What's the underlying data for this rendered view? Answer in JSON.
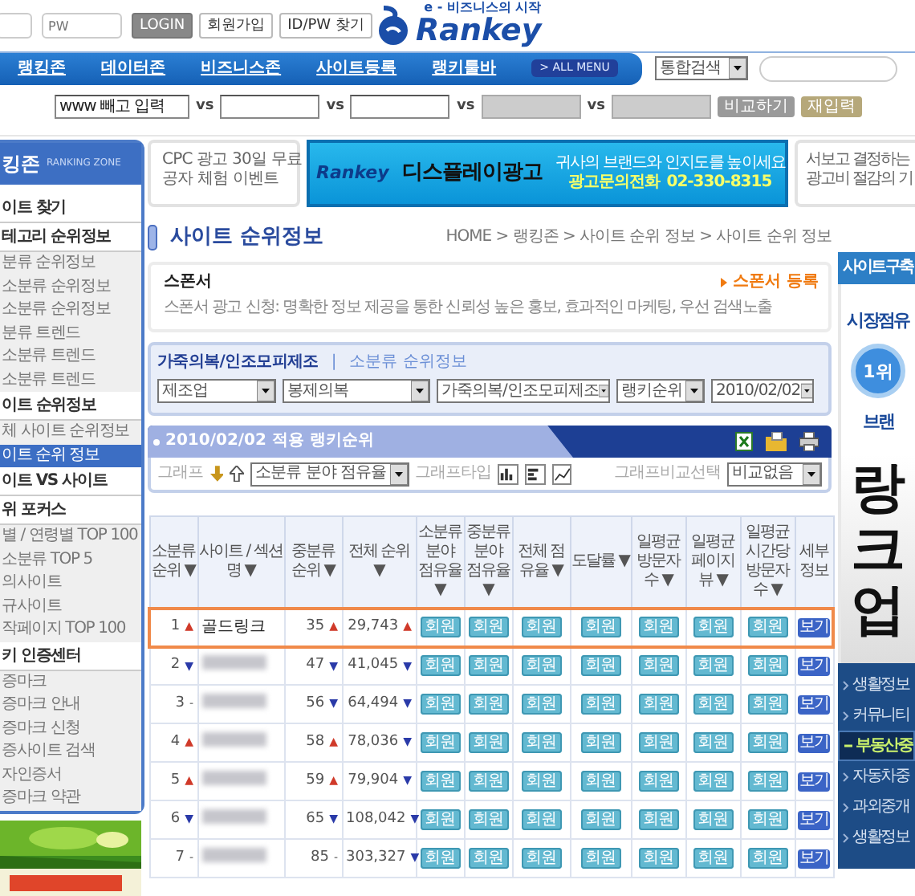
{
  "login": {
    "pw_placeholder": "PW",
    "buttons": [
      "LOGIN",
      "회원가입",
      "ID/PW 찾기"
    ]
  },
  "logo": {
    "tagline": "e - 비즈니스의 시작",
    "name": "Rankey"
  },
  "nav": {
    "items": [
      "랭킹존",
      "데이터존",
      "비즈니스존",
      "사이트등록",
      "랭키툴바"
    ],
    "all_menu": "> ALL MENU",
    "search_scope": "통합검색"
  },
  "compare": {
    "fields": [
      {
        "placeholder": "www 빼고 입력",
        "disabled": false
      },
      {
        "disabled": false
      },
      {
        "disabled": false
      },
      {
        "disabled": true
      },
      {
        "disabled": true
      }
    ],
    "separators": [
      "vs",
      "vs",
      "vs",
      "vs"
    ],
    "buttons": [
      {
        "label": "비교하기",
        "kind": "compare"
      },
      {
        "label": "재입력",
        "kind": "reset"
      }
    ]
  },
  "sidebar": {
    "title": "킹존",
    "subtitle": "RANKING ZONE",
    "items": [
      {
        "label": "이트 찾기",
        "kind": "heading",
        "selected": false
      },
      {
        "label": "테고리 순위정보",
        "kind": "heading",
        "selected": false
      },
      {
        "label": "분류 순위정보",
        "kind": "item",
        "selected": false
      },
      {
        "label": "소분류 순위정보",
        "kind": "item",
        "selected": false
      },
      {
        "label": "소분류 순위정보",
        "kind": "item",
        "selected": false
      },
      {
        "label": "분류 트렌드",
        "kind": "item",
        "selected": false
      },
      {
        "label": "소분류 트렌드",
        "kind": "item",
        "selected": false
      },
      {
        "label": "소분류 트렌드",
        "kind": "item",
        "selected": false
      },
      {
        "label": "이트 순위정보",
        "kind": "heading",
        "selected": false
      },
      {
        "label": "체 사이트 순위정보",
        "kind": "item",
        "selected": false
      },
      {
        "label": "이트 순위 정보",
        "kind": "item",
        "selected": true
      },
      {
        "label": "이트 VS 사이트",
        "kind": "heading",
        "selected": false
      },
      {
        "label": "위 포커스",
        "kind": "heading",
        "selected": false
      },
      {
        "label": "별 / 연령별 TOP 100",
        "kind": "item",
        "selected": false
      },
      {
        "label": "소분류 TOP 5",
        "kind": "item",
        "selected": false
      },
      {
        "label": "의사이트",
        "kind": "item",
        "selected": false
      },
      {
        "label": "규사이트",
        "kind": "item",
        "selected": false
      },
      {
        "label": "작페이지 TOP 100",
        "kind": "item",
        "selected": false
      },
      {
        "label": "키 인증센터",
        "kind": "heading",
        "selected": false
      },
      {
        "label": "증마크",
        "kind": "item",
        "selected": false
      },
      {
        "label": "증마크 안내",
        "kind": "item",
        "selected": false
      },
      {
        "label": "증마크 신청",
        "kind": "item",
        "selected": false
      },
      {
        "label": "증사이트 검색",
        "kind": "item",
        "selected": false
      },
      {
        "label": "자인증서",
        "kind": "item",
        "selected": false
      },
      {
        "label": "증마크 약관",
        "kind": "item",
        "selected": false
      }
    ]
  },
  "ads": {
    "promo": [
      "CPC 광고 30일 무료",
      "공자 체험 이벤트"
    ],
    "display": {
      "brand": "Rankey",
      "title": "디스플레이광고",
      "slogan": "귀사의 브랜드와 인지도를 높이세요",
      "contact_label": "광고문의전화",
      "phone": "02-330-8315"
    },
    "side_promo": [
      "서보고 결정하는",
      "광고비 절감의 기"
    ]
  },
  "page_title": "사이트 순위정보",
  "breadcrumb": "HOME > 랭킹존 > 사이트 순위 정보 > 사이트 순위 정보",
  "sponsor": {
    "title": "스폰서",
    "text": "스폰서 광고 신청: 명확한 정보 제공을 통한 신뢰성 높은 홍보, 효과적인 마케팅, 우선 검색노출",
    "link": "스폰서 등록"
  },
  "filter": {
    "category": "가죽의복/인조모피제조",
    "separator": "|",
    "link": "소분류 순위정보",
    "selects": [
      "제조업",
      "봉제의복",
      "가죽의복/인조모피제조",
      "랭키순위",
      "2010/02/02"
    ]
  },
  "results": {
    "title": "2010/02/02 적용 랭키순위",
    "graph_label": "그래프",
    "graph_metric": "소분류 분야 점유율",
    "type_label": "그래프타입",
    "graph_types": [
      {
        "kind": "bar"
      },
      {
        "kind": "hbar"
      },
      {
        "kind": "line"
      }
    ],
    "compare_label": "그래프비교선택",
    "compare_value": "비교없음"
  },
  "table": {
    "columns": [
      "소분류 순위 ▼",
      "사이트 / 섹션 명 ▼",
      "중분류 순위 ▼",
      "전체 순위 ▼",
      "소분류 분야 점유율 ▼",
      "중분류 분야 점유율 ▼",
      "전체 점유율 ▼",
      "도달률 ▼",
      "일평균 방문자 수 ▼",
      "일평균 페이지뷰 ▼",
      "일평균 시간당 방문자 수 ▼",
      "세부 정보"
    ],
    "rows": [
      {
        "rank": "1",
        "rank_change": {
          "kind": "up",
          "mark": "▲"
        },
        "site": "골드링크",
        "site_hidden": false,
        "mid_rank": "35",
        "mid_change": {
          "kind": "up",
          "mark": "▲"
        },
        "total_rank": "29,743",
        "total_change": {
          "kind": "up",
          "mark": "▲"
        },
        "locked": [
          "회원",
          "회원",
          "회원",
          "회원",
          "회원",
          "회원",
          "회원"
        ],
        "detail": "보기",
        "selected": true
      },
      {
        "rank": "2",
        "rank_change": {
          "kind": "down",
          "mark": "▼"
        },
        "site_hidden": true,
        "mid_rank": "47",
        "mid_change": {
          "kind": "down",
          "mark": "▼"
        },
        "total_rank": "41,045",
        "total_change": {
          "kind": "down",
          "mark": "▼"
        },
        "locked": [
          "회원",
          "회원",
          "회원",
          "회원",
          "회원",
          "회원",
          "회원"
        ],
        "detail": "보기",
        "selected": false
      },
      {
        "rank": "3",
        "rank_change": {
          "kind": "flat",
          "mark": "-"
        },
        "site_hidden": true,
        "mid_rank": "56",
        "mid_change": {
          "kind": "down",
          "mark": "▼"
        },
        "total_rank": "64,494",
        "total_change": {
          "kind": "down",
          "mark": "▼"
        },
        "locked": [
          "회원",
          "회원",
          "회원",
          "회원",
          "회원",
          "회원",
          "회원"
        ],
        "detail": "보기",
        "selected": false
      },
      {
        "rank": "4",
        "rank_change": {
          "kind": "up",
          "mark": "▲"
        },
        "site_hidden": true,
        "mid_rank": "58",
        "mid_change": {
          "kind": "up",
          "mark": "▲"
        },
        "total_rank": "78,036",
        "total_change": {
          "kind": "down",
          "mark": "▼"
        },
        "locked": [
          "회원",
          "회원",
          "회원",
          "회원",
          "회원",
          "회원",
          "회원"
        ],
        "detail": "보기",
        "selected": false
      },
      {
        "rank": "5",
        "rank_change": {
          "kind": "up",
          "mark": "▲"
        },
        "site_hidden": true,
        "mid_rank": "59",
        "mid_change": {
          "kind": "up",
          "mark": "▲"
        },
        "total_rank": "79,904",
        "total_change": {
          "kind": "down",
          "mark": "▼"
        },
        "locked": [
          "회원",
          "회원",
          "회원",
          "회원",
          "회원",
          "회원",
          "회원"
        ],
        "detail": "보기",
        "selected": false
      },
      {
        "rank": "6",
        "rank_change": {
          "kind": "down",
          "mark": "▼"
        },
        "site_hidden": true,
        "mid_rank": "65",
        "mid_change": {
          "kind": "down",
          "mark": "▼"
        },
        "total_rank": "108,042",
        "total_change": {
          "kind": "down",
          "mark": "▼"
        },
        "locked": [
          "회원",
          "회원",
          "회원",
          "회원",
          "회원",
          "회원",
          "회원"
        ],
        "detail": "보기",
        "selected": false
      },
      {
        "rank": "7",
        "rank_change": {
          "kind": "flat",
          "mark": "-"
        },
        "site_hidden": true,
        "mid_rank": "85",
        "mid_change": {
          "kind": "flat",
          "mark": "-"
        },
        "total_rank": "303,327",
        "total_change": {
          "kind": "down",
          "mark": "▼"
        },
        "locked": [
          "회원",
          "회원",
          "회원",
          "회원",
          "회원",
          "회원",
          "회원"
        ],
        "detail": "보기",
        "selected": false
      }
    ]
  },
  "right_panel": {
    "header": "사이트구축",
    "ad_lines": [
      "시장점유",
      "1위",
      "브랜"
    ],
    "big_letters": [
      "랑",
      "크",
      "업"
    ],
    "menu": [
      {
        "label": "생활정보",
        "selected": false
      },
      {
        "label": "커뮤니티",
        "selected": false
      },
      {
        "label": "부동산중",
        "selected": true
      },
      {
        "label": "자동차중",
        "selected": false
      },
      {
        "label": "과외중개",
        "selected": false
      },
      {
        "label": "생활정보",
        "selected": false
      }
    ]
  }
}
